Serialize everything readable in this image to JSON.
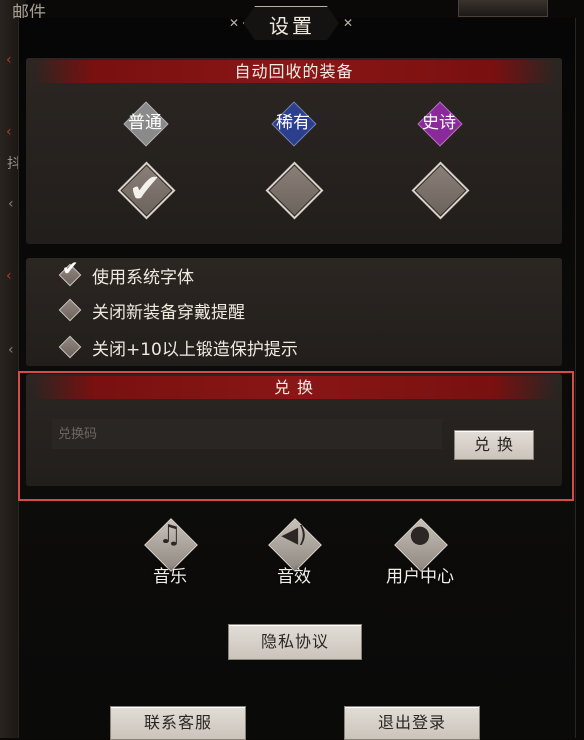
{
  "background": {
    "tab_label": "邮件",
    "side_char": "抖"
  },
  "dialog": {
    "title": "设置"
  },
  "auto_recycle": {
    "header": "自动回收的装备",
    "rarities": [
      {
        "label": "普通",
        "color": "#8a8a8a",
        "checked": true
      },
      {
        "label": "稀有",
        "color": "#2c3f8f",
        "checked": false
      },
      {
        "label": "史诗",
        "color": "#8a2a9a",
        "checked": false
      }
    ]
  },
  "options": [
    {
      "label": "使用系统字体",
      "checked": true
    },
    {
      "label": "关闭新装备穿戴提醒",
      "checked": false
    },
    {
      "label": "关闭+10以上锻造保护提示",
      "checked": false
    }
  ],
  "redeem": {
    "header": "兑 换",
    "placeholder": "兑换码",
    "value": "",
    "button": "兑 换"
  },
  "icons": [
    {
      "label": "音乐",
      "icon": "music-note-icon"
    },
    {
      "label": "音效",
      "icon": "speaker-icon"
    },
    {
      "label": "用户中心",
      "icon": "user-icon"
    }
  ],
  "buttons": {
    "privacy": "隐私协议",
    "support": "联系客服",
    "logout": "退出登录"
  },
  "colors": {
    "header_red": "#8a1616",
    "highlight_outline": "#d64a4a"
  }
}
